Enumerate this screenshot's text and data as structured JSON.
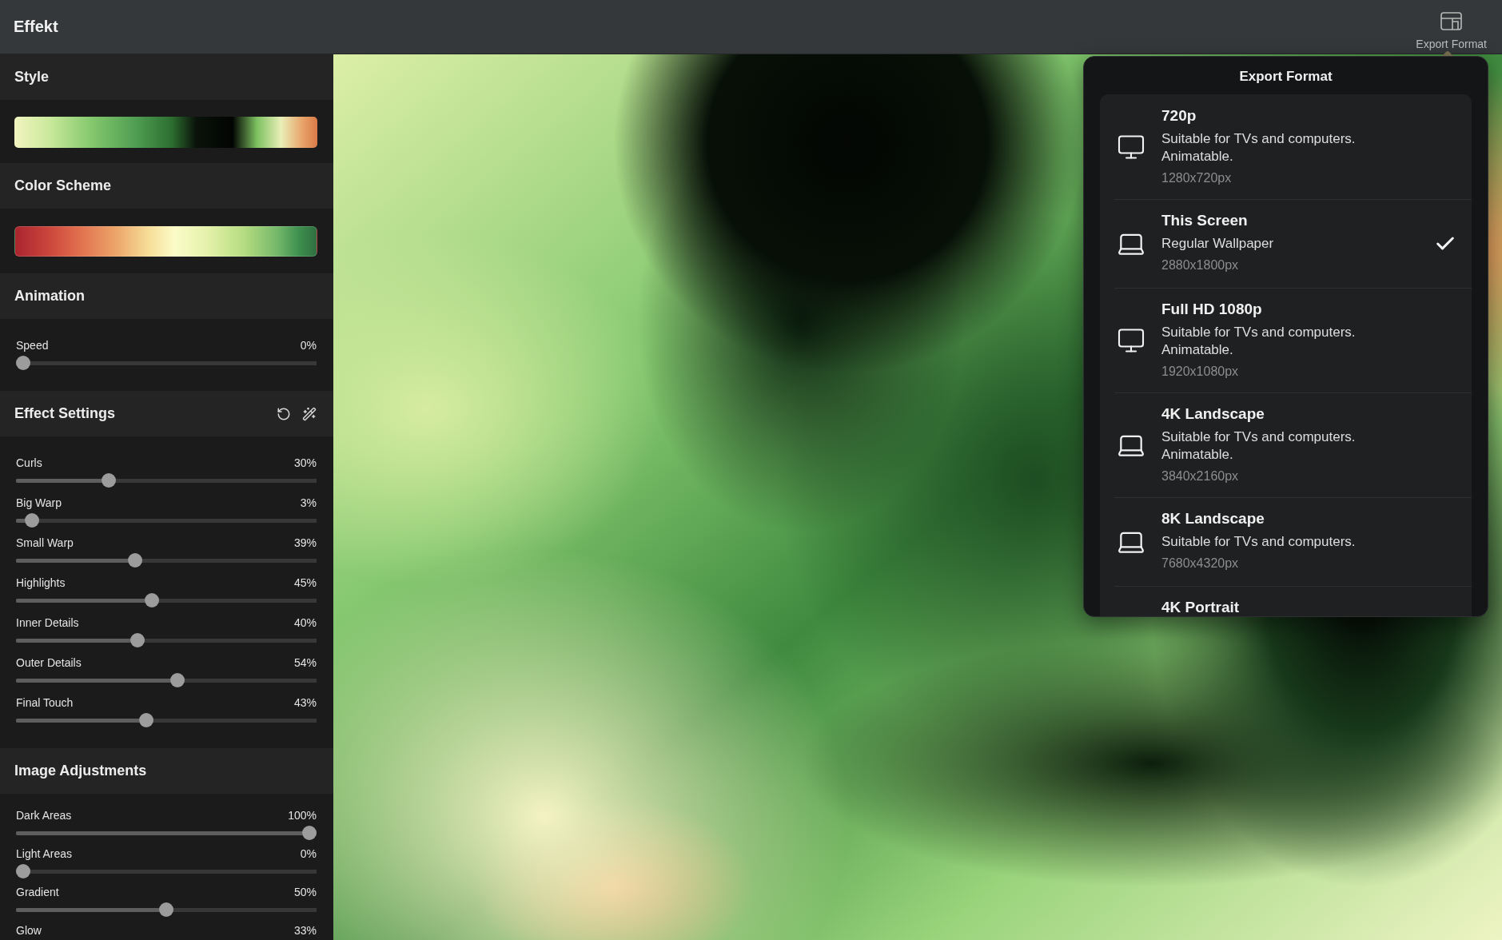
{
  "app_bar": {
    "title": "Effekt",
    "export_button": {
      "label": "Export Format"
    }
  },
  "sidebar": {
    "sections": [
      {
        "kind": "style",
        "title": "Style"
      },
      {
        "kind": "color_scheme",
        "title": "Color Scheme"
      },
      {
        "kind": "sliders",
        "title": "Animation",
        "sliders": [
          {
            "label": "Speed",
            "reading": "0%",
            "level": 0
          }
        ]
      },
      {
        "kind": "sliders",
        "title": "Effect Settings",
        "tools": true,
        "sliders": [
          {
            "label": "Curls",
            "reading": "30%",
            "level": 0.3
          },
          {
            "label": "Big Warp",
            "reading": "3%",
            "level": 0.03
          },
          {
            "label": "Small Warp",
            "reading": "39%",
            "level": 0.39
          },
          {
            "label": "Highlights",
            "reading": "45%",
            "level": 0.45
          },
          {
            "label": "Inner Details",
            "reading": "40%",
            "level": 0.4
          },
          {
            "label": "Outer Details",
            "reading": "54%",
            "level": 0.54
          },
          {
            "label": "Final Touch",
            "reading": "43%",
            "level": 0.43
          }
        ]
      },
      {
        "kind": "sliders",
        "title": "Image Adjustments",
        "sliders": [
          {
            "label": "Dark Areas",
            "reading": "100%",
            "level": 1
          },
          {
            "label": "Light Areas",
            "reading": "0%",
            "level": 0
          },
          {
            "label": "Gradient",
            "reading": "50%",
            "level": 0.5
          },
          {
            "label": "Glow",
            "reading": "33%"
          }
        ]
      }
    ]
  },
  "export_popover": {
    "title": "Export Format",
    "options": [
      {
        "kind": "monitor",
        "name": "720p",
        "description": "Suitable for TVs and computers.\nAnimatable.",
        "size": "1280x720px",
        "selected": false
      },
      {
        "kind": "laptop",
        "name": "This Screen",
        "description": "Regular Wallpaper",
        "size": "2880x1800px",
        "selected": true
      },
      {
        "kind": "monitor",
        "name": "Full HD 1080p",
        "description": "Suitable for TVs and computers.\nAnimatable.",
        "size": "1920x1080px",
        "selected": false
      },
      {
        "kind": "laptop",
        "name": "4K Landscape",
        "description": "Suitable for TVs and computers.\nAnimatable.",
        "size": "3840x2160px",
        "selected": false
      },
      {
        "kind": "laptop",
        "name": "8K Landscape",
        "description": "Suitable for TVs and computers.",
        "size": "7680x4320px",
        "selected": false
      },
      {
        "name": "4K Portrait",
        "selected": false
      }
    ]
  }
}
